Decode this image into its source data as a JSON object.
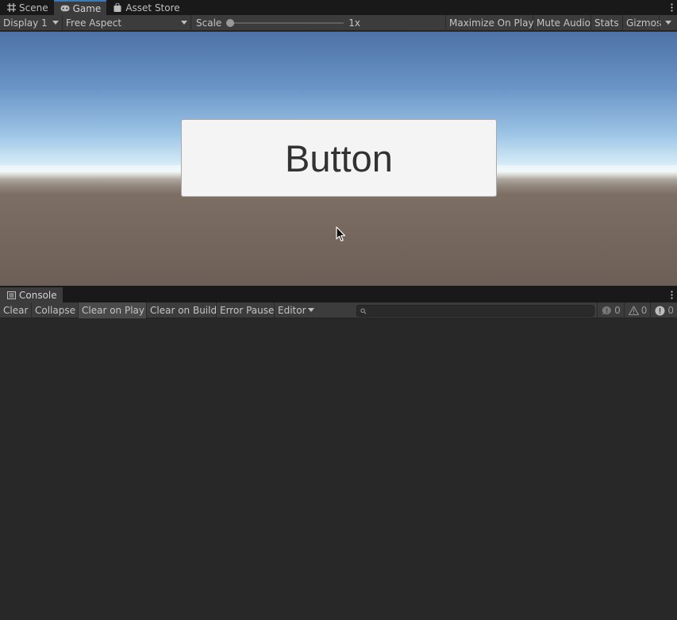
{
  "top_tabs": [
    {
      "label": "Scene",
      "icon": "grid-icon"
    },
    {
      "label": "Game",
      "icon": "gamepad-icon"
    },
    {
      "label": "Asset Store",
      "icon": "shopping-bag-icon"
    }
  ],
  "game_toolbar": {
    "display": "Display 1",
    "aspect": "Free Aspect",
    "scale_label": "Scale",
    "scale_value": "1x",
    "maximize": "Maximize On Play",
    "mute": "Mute Audio",
    "stats": "Stats",
    "gizmos": "Gizmos"
  },
  "game_view": {
    "button_label": "Button"
  },
  "console_tab": {
    "label": "Console",
    "icon": "console-icon"
  },
  "console_toolbar": {
    "clear": "Clear",
    "collapse": "Collapse",
    "clear_on_play": "Clear on Play",
    "clear_on_build": "Clear on Build",
    "error_pause": "Error Pause",
    "editor": "Editor",
    "search_placeholder": "",
    "info_count": "0",
    "warning_count": "0",
    "error_count": "0"
  },
  "colors": {
    "accent": "#3a79bb",
    "panel": "#3c3c3c",
    "background": "#282828"
  }
}
